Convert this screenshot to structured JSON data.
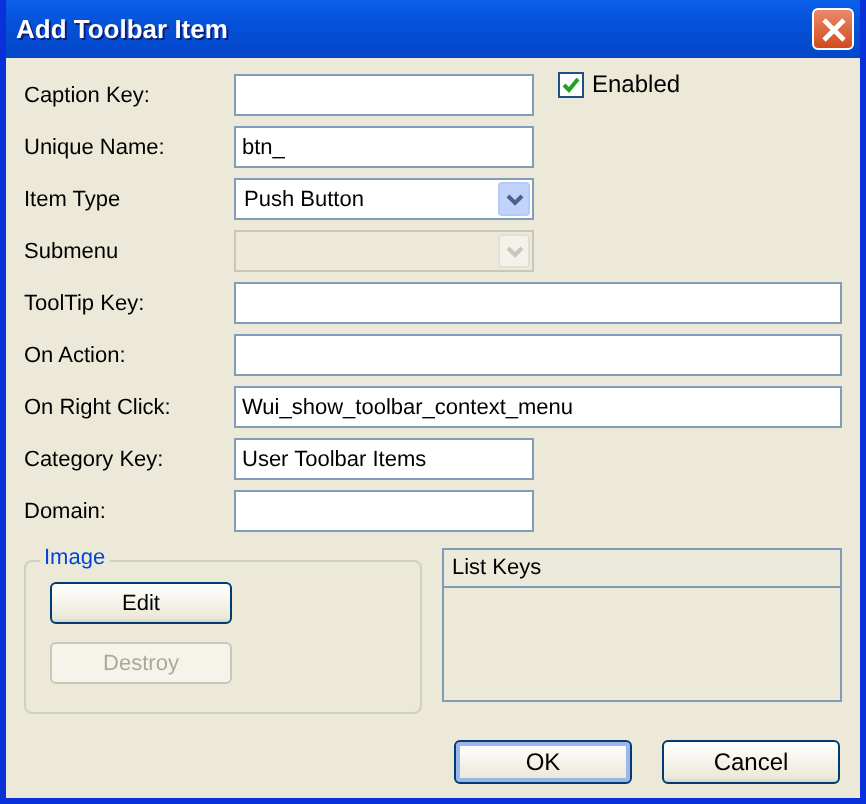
{
  "window": {
    "title": "Add Toolbar Item"
  },
  "enabled_checkbox": {
    "label": "Enabled",
    "checked": true
  },
  "fields": [
    {
      "label": "Caption Key:",
      "kind": "text",
      "disabled": false
    },
    {
      "label": "Unique Name:",
      "kind": "text",
      "value": "btn_",
      "disabled": false
    },
    {
      "label": "Item Type",
      "kind": "select",
      "value": "Push Button",
      "disabled": false
    },
    {
      "label": "Submenu",
      "kind": "select",
      "disabled": true
    },
    {
      "label": "ToolTip Key:",
      "kind": "text",
      "disabled": false
    },
    {
      "label": "On Action:",
      "kind": "text",
      "disabled": false
    },
    {
      "label": "On Right Click:",
      "kind": "text",
      "value": "Wui_show_toolbar_context_menu",
      "disabled": false
    },
    {
      "label": "Category Key:",
      "kind": "text",
      "value": "User Toolbar Items",
      "disabled": false
    },
    {
      "label": "Domain:",
      "kind": "text",
      "disabled": false
    }
  ],
  "image_group": {
    "title": "Image",
    "buttons": [
      {
        "label": "Edit",
        "disabled": false
      },
      {
        "label": "Destroy",
        "disabled": true
      }
    ]
  },
  "list_keys": {
    "header": "List Keys"
  },
  "buttons": [
    {
      "label": "OK",
      "default": true
    },
    {
      "label": "Cancel",
      "default": false
    }
  ]
}
